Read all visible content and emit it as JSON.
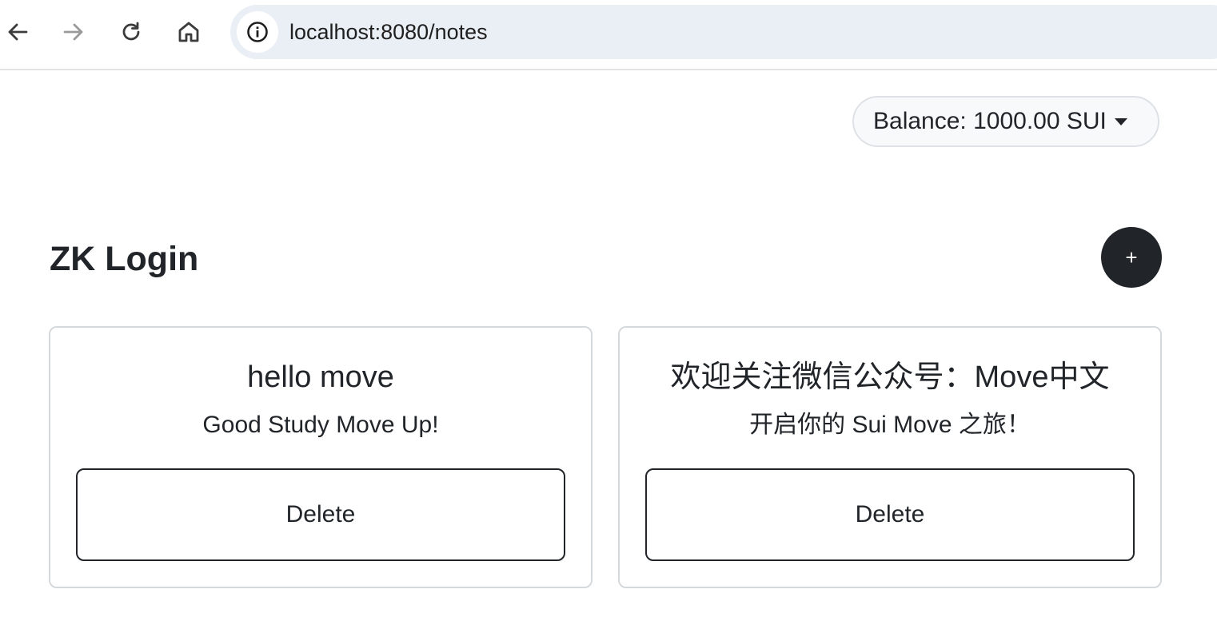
{
  "browser": {
    "url": "localhost:8080/notes",
    "icons": {
      "back": "arrow-left-icon",
      "forward": "arrow-right-icon",
      "reload": "reload-icon",
      "home": "home-icon",
      "site_info": "info-icon"
    }
  },
  "header": {
    "balance_label": "Balance: 1000.00 SUI"
  },
  "main": {
    "title": "ZK Login",
    "add_label": "+",
    "notes": [
      {
        "title": "hello move",
        "content": "Good Study Move Up!",
        "delete_label": "Delete"
      },
      {
        "title": "欢迎关注微信公众号：Move中文",
        "content": "开启你的 Sui Move 之旅！",
        "delete_label": "Delete"
      }
    ]
  },
  "colors": {
    "primary_dark": "#212529",
    "url_bar_bg": "#eaeef5",
    "balance_bg": "#f8f9fa",
    "card_border": "#d6d9dc"
  }
}
